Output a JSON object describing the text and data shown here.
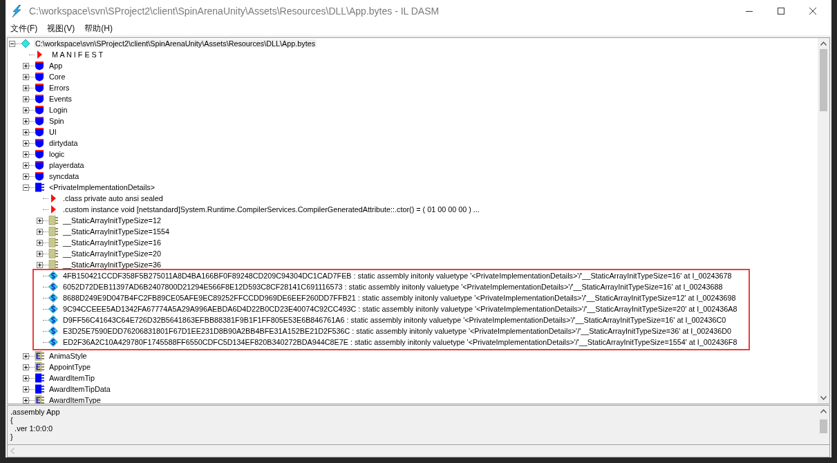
{
  "window": {
    "title": "C:\\workspace\\svn\\SProject2\\client\\SpinArenaUnity\\Assets\\Resources\\DLL\\App.bytes - IL DASM"
  },
  "menu": [
    {
      "label": "文件(F)"
    },
    {
      "label": "视图(V)"
    },
    {
      "label": "帮助(H)"
    }
  ],
  "tree": {
    "root": {
      "kind": "assembly",
      "label": "C:\\workspace\\svn\\SProject2\\client\\SpinArenaUnity\\Assets\\Resources\\DLL\\App.bytes",
      "expanded": true,
      "selected": true,
      "children": [
        {
          "kind": "manifest",
          "label": "M A N I F E S T"
        },
        {
          "kind": "namespace",
          "label": "App",
          "expanded": false
        },
        {
          "kind": "namespace",
          "label": "Core",
          "expanded": false
        },
        {
          "kind": "namespace",
          "label": "Errors",
          "expanded": false
        },
        {
          "kind": "namespace",
          "label": "Events",
          "expanded": false
        },
        {
          "kind": "namespace",
          "label": "Login",
          "expanded": false
        },
        {
          "kind": "namespace",
          "label": "Spin",
          "expanded": false
        },
        {
          "kind": "namespace",
          "label": "UI",
          "expanded": false
        },
        {
          "kind": "namespace",
          "label": "dirtydata",
          "expanded": false
        },
        {
          "kind": "namespace",
          "label": "logic",
          "expanded": false
        },
        {
          "kind": "namespace",
          "label": "playerdata",
          "expanded": false
        },
        {
          "kind": "namespace",
          "label": "syncdata",
          "expanded": false
        },
        {
          "kind": "class",
          "label": "<PrivateImplementationDetails>",
          "expanded": true,
          "children": [
            {
              "kind": "directive",
              "label": ".class private auto ansi sealed"
            },
            {
              "kind": "directive",
              "label": ".custom instance void [netstandard]System.Runtime.CompilerServices.CompilerGeneratedAttribute::.ctor() = ( 01 00 00 00 )  ..."
            },
            {
              "kind": "valuetype",
              "label": "__StaticArrayInitTypeSize=12",
              "expanded": false
            },
            {
              "kind": "valuetype",
              "label": "__StaticArrayInitTypeSize=1554",
              "expanded": false
            },
            {
              "kind": "valuetype",
              "label": "__StaticArrayInitTypeSize=16",
              "expanded": false
            },
            {
              "kind": "valuetype",
              "label": "__StaticArrayInitTypeSize=20",
              "expanded": false
            },
            {
              "kind": "valuetype",
              "label": "__StaticArrayInitTypeSize=36",
              "expanded": false
            },
            {
              "kind": "field",
              "highlighted": true,
              "label": "4FB150421CCDF358F5B275011A8D4BA166BF0F89248CD209C94304DC1CAD7FEB : static assembly initonly valuetype '<PrivateImplementationDetails>'/'__StaticArrayInitTypeSize=16' at I_00243678"
            },
            {
              "kind": "field",
              "highlighted": true,
              "label": "6052D72DEB11397AD6B2407800D21294E566F8E12D593C8CF28141C691116573 : static assembly initonly valuetype '<PrivateImplementationDetails>'/'__StaticArrayInitTypeSize=16' at I_00243688"
            },
            {
              "kind": "field",
              "highlighted": true,
              "label": "8688D249E9D047B4FC2FB89CE05AFE9EC89252FFCCDD969DE6EEF260DD7FFB21 : static assembly initonly valuetype '<PrivateImplementationDetails>'/'__StaticArrayInitTypeSize=12' at I_00243698"
            },
            {
              "kind": "field",
              "highlighted": true,
              "label": "9C94CCEEE5AD1342FA67774A5A29A996AEBDA6D4D22B0CD23E40074C92CC493C : static assembly initonly valuetype '<PrivateImplementationDetails>'/'__StaticArrayInitTypeSize=20' at I_002436A8"
            },
            {
              "kind": "field",
              "highlighted": true,
              "label": "D9FF56C41643C64E726D32B5641863EFBB88381F9B1F1FF805E53E6B846761A6 : static assembly initonly valuetype '<PrivateImplementationDetails>'/'__StaticArrayInitTypeSize=16' at I_002436C0"
            },
            {
              "kind": "field",
              "highlighted": true,
              "label": "E3D25E7590EDD76206831801F67D1EE231D8B90A2BB4BFE31A152BE21D2F536C : static assembly initonly valuetype '<PrivateImplementationDetails>'/'__StaticArrayInitTypeSize=36' at I_002436D0"
            },
            {
              "kind": "field",
              "highlighted": true,
              "label": "ED2F36A2C10A429780F1745588FF6550CDFC5D134EF820B340272BDA944C8E7E : static assembly initonly valuetype '<PrivateImplementationDetails>'/'__StaticArrayInitTypeSize=1554' at I_002436F8"
            }
          ]
        },
        {
          "kind": "enum",
          "label": "AnimaStyle",
          "expanded": false
        },
        {
          "kind": "enum",
          "label": "AppointType",
          "expanded": false
        },
        {
          "kind": "class",
          "label": "AwardItemTip",
          "expanded": false
        },
        {
          "kind": "class",
          "label": "AwardItemTipData",
          "expanded": false
        },
        {
          "kind": "enum",
          "label": "AwardItemType",
          "expanded": false
        }
      ]
    }
  },
  "detail": {
    "lines": [
      ".assembly App",
      "{",
      "  .ver 1:0:0:0",
      "}"
    ]
  }
}
